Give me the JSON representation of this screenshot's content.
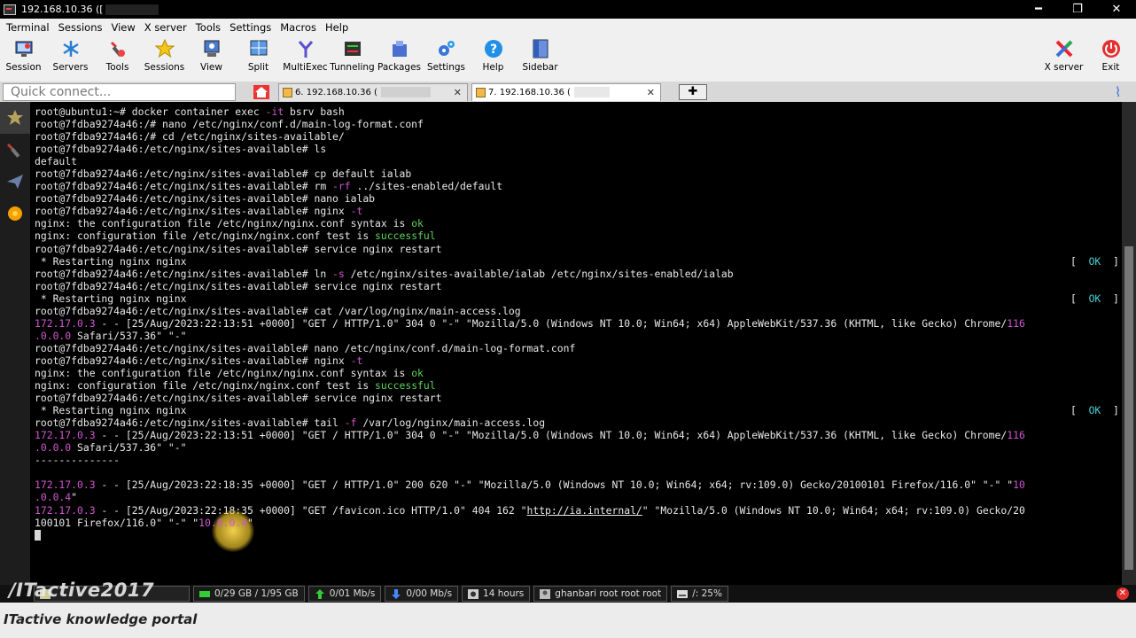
{
  "window": {
    "title": "192.168.10.36 ([",
    "controls": {
      "minimize": "━",
      "restore": "❐",
      "close": "✕"
    }
  },
  "menu": [
    "Terminal",
    "Sessions",
    "View",
    "X server",
    "Tools",
    "Settings",
    "Macros",
    "Help"
  ],
  "toolbar": [
    "Session",
    "Servers",
    "Tools",
    "Sessions",
    "View",
    "Split",
    "MultiExec",
    "Tunneling",
    "Packages",
    "Settings",
    "Help",
    "Sidebar"
  ],
  "toolbar_right": [
    "X server",
    "Exit"
  ],
  "quick_connect": {
    "placeholder": "Quick connect..."
  },
  "tabs": [
    {
      "label": "6. 192.168.10.36 (",
      "active": false
    },
    {
      "label": "7. 192.168.10.36 (",
      "active": true
    }
  ],
  "terminal": {
    "lines": [
      "root@ubuntu1:~# docker container exec -it bsrv bash",
      "root@7fdba9274a46:/# nano /etc/nginx/conf.d/main-log-format.conf",
      "root@7fdba9274a46:/# cd /etc/nginx/sites-available/",
      "root@7fdba9274a46:/etc/nginx/sites-available# ls",
      "default",
      "root@7fdba9274a46:/etc/nginx/sites-available# cp default ialab",
      "root@7fdba9274a46:/etc/nginx/sites-available# rm -rf ../sites-enabled/default",
      "root@7fdba9274a46:/etc/nginx/sites-available# nano ialab",
      "root@7fdba9274a46:/etc/nginx/sites-available# nginx -t",
      "nginx: the configuration file /etc/nginx/nginx.conf syntax is ok",
      "nginx: configuration file /etc/nginx/nginx.conf test is successful",
      "root@7fdba9274a46:/etc/nginx/sites-available# service nginx restart",
      " * Restarting nginx nginx",
      "root@7fdba9274a46:/etc/nginx/sites-available# ln -s /etc/nginx/sites-available/ialab /etc/nginx/sites-enabled/ialab",
      "root@7fdba9274a46:/etc/nginx/sites-available# service nginx restart",
      " * Restarting nginx nginx",
      "root@7fdba9274a46:/etc/nginx/sites-available# cat /var/log/nginx/main-access.log",
      "172.17.0.3 - - [25/Aug/2023:22:13:51 +0000] \"GET / HTTP/1.0\" 304 0 \"-\" \"Mozilla/5.0 (Windows NT 10.0; Win64; x64) AppleWebKit/537.36 (KHTML, like Gecko) Chrome/116",
      ".0.0.0 Safari/537.36\" \"-\"",
      "root@7fdba9274a46:/etc/nginx/sites-available# nano /etc/nginx/conf.d/main-log-format.conf",
      "root@7fdba9274a46:/etc/nginx/sites-available# nginx -t",
      "nginx: the configuration file /etc/nginx/nginx.conf syntax is ok",
      "nginx: configuration file /etc/nginx/nginx.conf test is successful",
      "root@7fdba9274a46:/etc/nginx/sites-available# service nginx restart",
      " * Restarting nginx nginx",
      "root@7fdba9274a46:/etc/nginx/sites-available# tail -f /var/log/nginx/main-access.log",
      "172.17.0.3 - - [25/Aug/2023:22:13:51 +0000] \"GET / HTTP/1.0\" 304 0 \"-\" \"Mozilla/5.0 (Windows NT 10.0; Win64; x64) AppleWebKit/537.36 (KHTML, like Gecko) Chrome/116",
      ".0.0.0 Safari/537.36\" \"-\"",
      "--------------",
      "",
      "172.17.0.3 - - [25/Aug/2023:22:18:35 +0000] \"GET / HTTP/1.0\" 200 620 \"-\" \"Mozilla/5.0 (Windows NT 10.0; Win64; x64; rv:109.0) Gecko/20100101 Firefox/116.0\" \"-\" \"10",
      ".0.0.4\"",
      "172.17.0.3 - - [25/Aug/2023:22:18:35 +0000] \"GET /favicon.ico HTTP/1.0\" 404 162 \"http://ia.internal/\" \"Mozilla/5.0 (Windows NT 10.0; Win64; x64; rv:109.0) Gecko/20",
      "100101 Firefox/116.0\" \"-\" \"10.0.0.4\""
    ],
    "ok_marker": "[  OK  ]"
  },
  "status": {
    "disk": "0/29 GB / 1/95 GB",
    "upload": "0/01 Mb/s",
    "download": "0/00 Mb/s",
    "uptime": "14 hours",
    "user": "ghanbari  root  root  root",
    "cpu": "/: 25%"
  },
  "watermark": "/ITactive2017",
  "footer": "ITactive knowledge portal"
}
